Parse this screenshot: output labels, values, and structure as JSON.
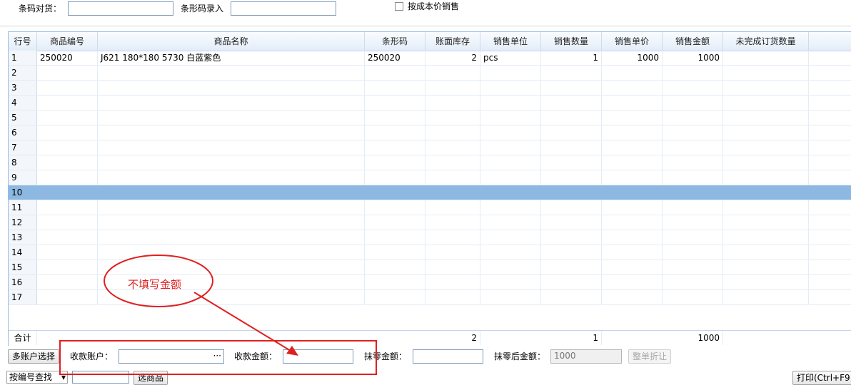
{
  "toolbar": {
    "barcode_check_label": "条码对货：",
    "barcode_check_value": "",
    "barcode_entry_label": "条形码录入",
    "barcode_entry_value": "",
    "cost_price_sale_label": "按成本价销售",
    "cost_price_sale_checked": false
  },
  "grid": {
    "columns": [
      "行号",
      "商品编号",
      "商品名称",
      "条形码",
      "账面库存",
      "销售单位",
      "销售数量",
      "销售单价",
      "销售金额",
      "未完成订货数量"
    ],
    "rows": [
      {
        "no": "1",
        "code": "250020",
        "name": "J621 180*180 5730 白蓝紫色",
        "barcode": "250020",
        "stock": "2",
        "unit": "pcs",
        "qty": "1",
        "price": "1000",
        "amount": "1000",
        "pending": ""
      },
      {
        "no": "2"
      },
      {
        "no": "3"
      },
      {
        "no": "4"
      },
      {
        "no": "5"
      },
      {
        "no": "6"
      },
      {
        "no": "7"
      },
      {
        "no": "8"
      },
      {
        "no": "9"
      },
      {
        "no": "10",
        "selected": true
      },
      {
        "no": "11"
      },
      {
        "no": "12"
      },
      {
        "no": "13"
      },
      {
        "no": "14"
      },
      {
        "no": "15"
      },
      {
        "no": "16"
      },
      {
        "no": "17"
      }
    ],
    "summary": {
      "label": "合计",
      "stock": "2",
      "qty": "1",
      "amount": "1000"
    }
  },
  "annotation": {
    "bubble_text": "不填写金额",
    "color": "#e02020"
  },
  "payment": {
    "multi_account_button": "多账户选择",
    "account_label": "收款账户：",
    "account_value": "",
    "account_picker": "···",
    "amount_label": "收款金额：",
    "amount_value": "",
    "rounding_label": "抹零金额：",
    "rounding_value": "",
    "after_rounding_label": "抹零后金额：",
    "after_rounding_value": "1000",
    "discount_button": "整单折让"
  },
  "bottom": {
    "search_select": "按编号查找",
    "select_button": "选商品",
    "print_button": "打印(Ctrl+F9"
  }
}
